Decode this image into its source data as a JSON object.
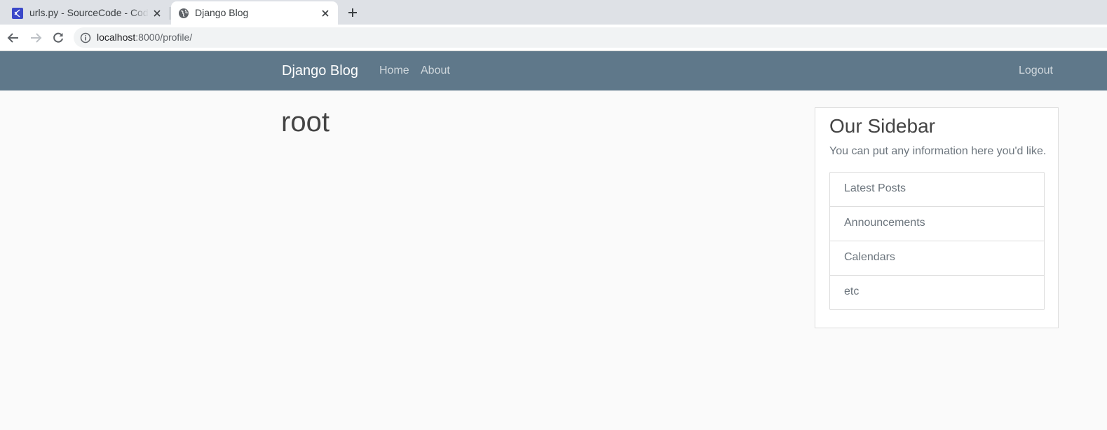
{
  "browser": {
    "tabs": [
      {
        "title": "urls.py - SourceCode - Code - OSS",
        "favicon": "vscode-icon",
        "active": false
      },
      {
        "title": "Django Blog",
        "favicon": "globe-icon",
        "active": true
      }
    ],
    "url_host": "localhost",
    "url_rest": ":8000/profile/"
  },
  "navbar": {
    "brand": "Django Blog",
    "home": "Home",
    "about": "About",
    "logout": "Logout",
    "background": "#5f788a"
  },
  "main": {
    "username": "root"
  },
  "sidebar": {
    "title": "Our Sidebar",
    "text": "You can put any information here you'd like.",
    "items": [
      "Latest Posts",
      "Announcements",
      "Calendars",
      "etc"
    ]
  }
}
